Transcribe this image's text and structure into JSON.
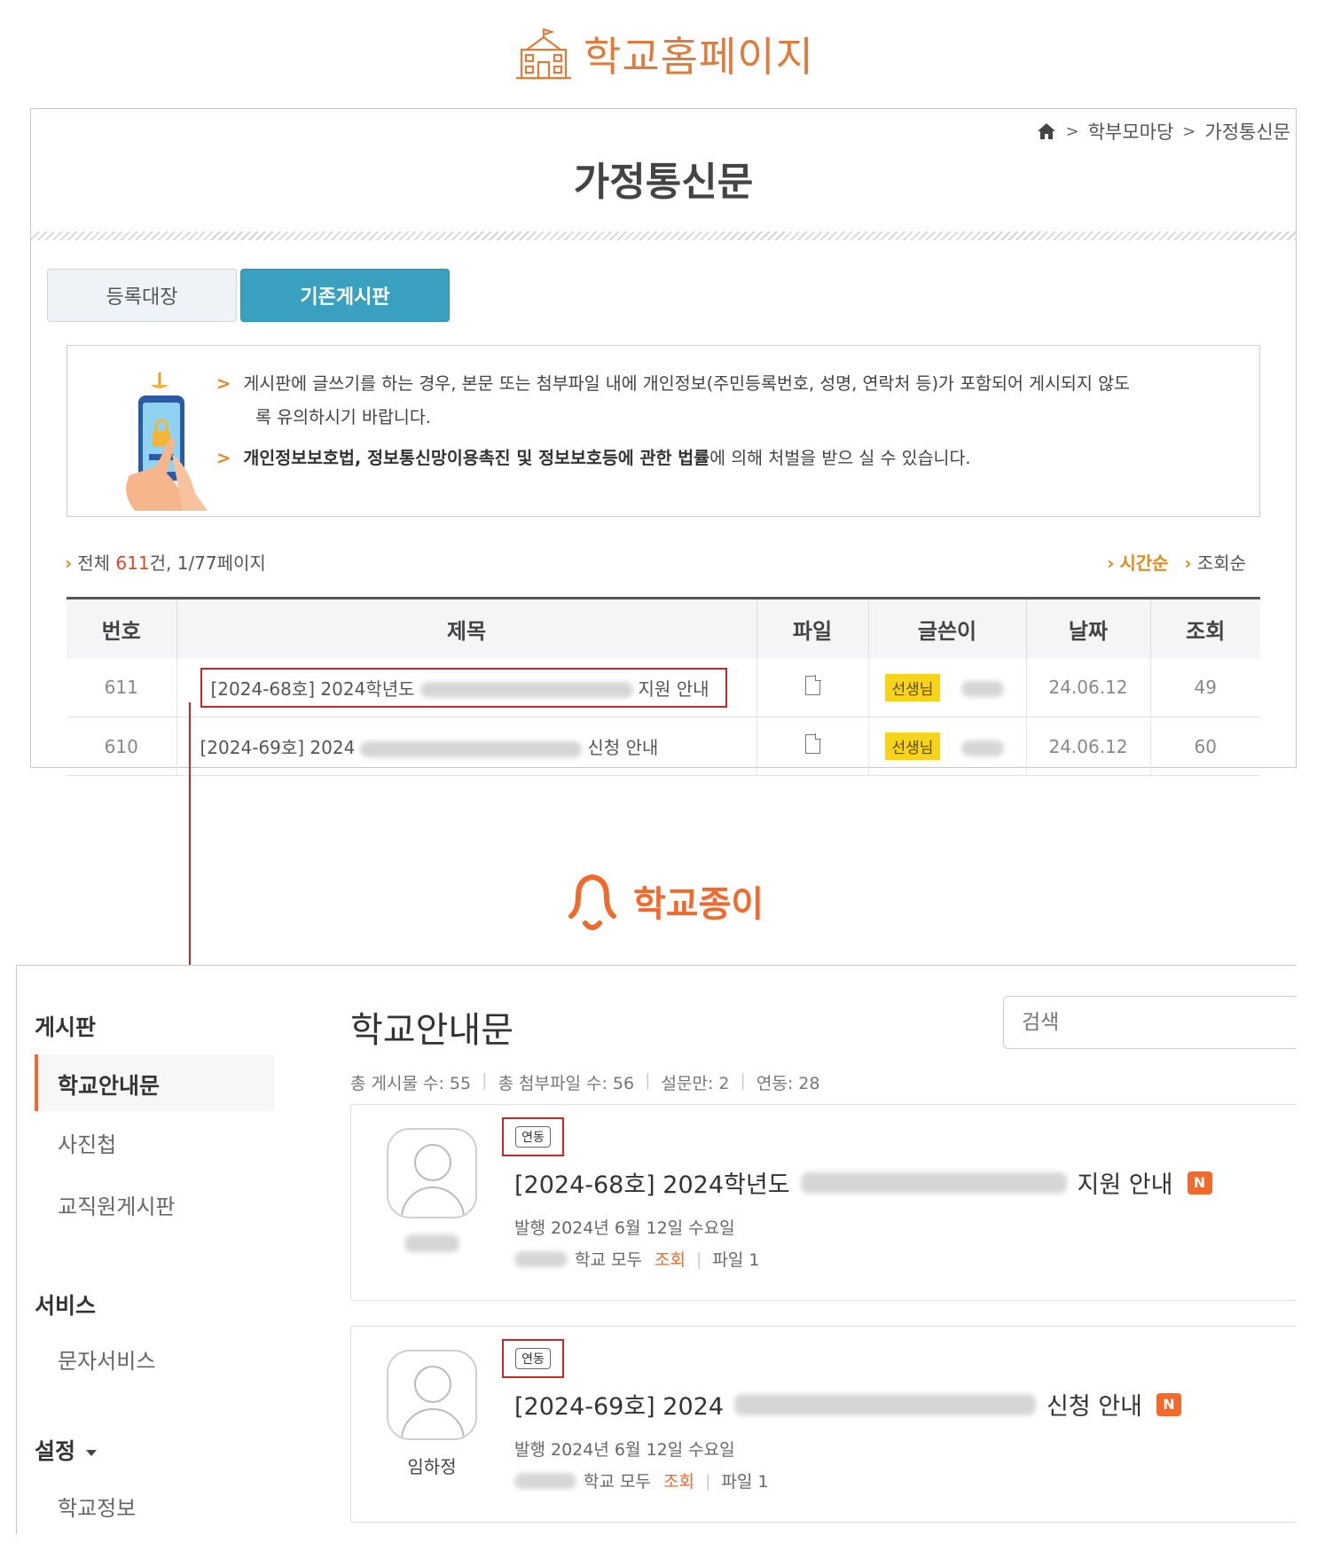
{
  "top_logo": {
    "brand": "학교홈페이지",
    "icon": "school-building-icon",
    "color": "#e07b3c"
  },
  "panel1": {
    "breadcrumb": {
      "home_icon": "home-icon",
      "items": [
        "학부모마당",
        "가정통신문"
      ]
    },
    "title": "가정통신문",
    "tabs": [
      {
        "label": "등록대장",
        "active": false
      },
      {
        "label": "기존게시판",
        "active": true
      }
    ],
    "notice": {
      "line1": "게시판에 글쓰기를 하는 경우, 본문 또는 첨부파일 내에 개인정보(주민등록번호, 성명, 연락처 등)가 포함되어 게시되지 않도",
      "line1b": "록 유의하시기 바랍니다.",
      "line2_bold": "개인정보보호법, 정보통신망이용촉진 및 정보보호등에 관한 법률",
      "line2_rest": "에 의해 처벌을 받으 실 수 있습니다."
    },
    "count": {
      "prefix": "전체 ",
      "total": "611",
      "suffix": "건, 1/77페이지"
    },
    "sort": {
      "active": "시간순",
      "other": "조회순"
    },
    "columns": [
      "번호",
      "제목",
      "파일",
      "글쓴이",
      "날짜",
      "조회"
    ],
    "rows": [
      {
        "no": "611",
        "title_start": "[2024-68호] 2024학년도",
        "title_end": "지원 안내",
        "badge": "선생님",
        "date": "24.06.12",
        "views": "49"
      },
      {
        "no": "610",
        "title_start": "[2024-69호] 2024",
        "title_end": "신청 안내",
        "badge": "선생님",
        "date": "24.06.12",
        "views": "60"
      }
    ]
  },
  "bottom_logo": {
    "brand": "학교종이",
    "color": "#ef6a2c"
  },
  "panel2": {
    "sidebar": {
      "board_heading": "게시판",
      "board_items": [
        "학교안내문",
        "사진첩",
        "교직원게시판"
      ],
      "service_heading": "서비스",
      "service_items": [
        "문자서비스"
      ],
      "settings_heading": "설정",
      "settings_items": [
        "학교정보"
      ]
    },
    "title": "학교안내문",
    "search_placeholder": "검색",
    "stats": [
      "총 게시물 수: 55",
      "총 첨부파일 수: 56",
      "설문만: 2",
      "연동: 28"
    ],
    "cards": [
      {
        "tag": "연동",
        "title_start": "[2024-68호] 2024학년도",
        "title_end": "지원 안내",
        "new": "N",
        "date": "발행 2024년 6월 12일 수요일",
        "target": "학교 모두",
        "views_label": "조회",
        "files": "파일 1",
        "author": ""
      },
      {
        "tag": "연동",
        "title_start": "[2024-69호] 2024",
        "title_end": "신청 안내",
        "new": "N",
        "date": "발행 2024년 6월 12일 수요일",
        "target": "학교 모두",
        "views_label": "조회",
        "files": "파일 1",
        "author": "임하정"
      }
    ]
  }
}
